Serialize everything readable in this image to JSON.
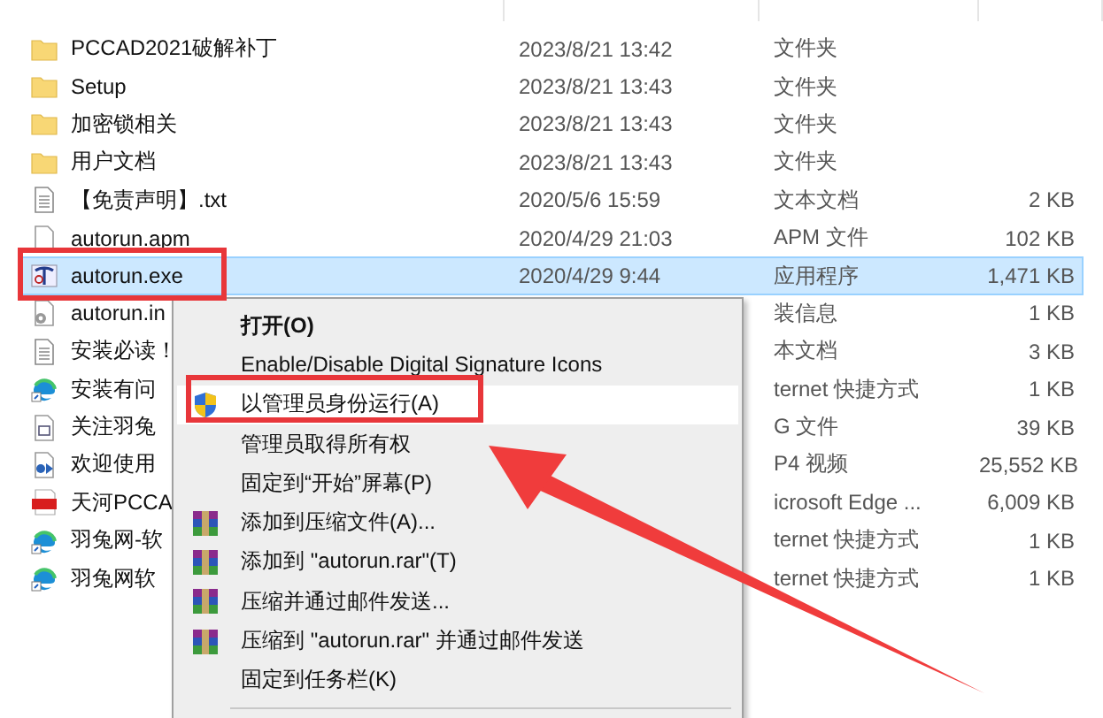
{
  "files": [
    {
      "kind": "folder",
      "name": "PCCAD2021破解补丁",
      "date": "2023/8/21 13:42",
      "type": "文件夹",
      "selected": false
    },
    {
      "kind": "folder",
      "name": "Setup",
      "date": "2023/8/21 13:43",
      "type": "文件夹",
      "selected": false
    },
    {
      "kind": "folder",
      "name": "加密锁相关",
      "date": "2023/8/21 13:43",
      "type": "文件夹",
      "selected": false
    },
    {
      "kind": "folder",
      "name": "用户文档",
      "date": "2023/8/21 13:43",
      "type": "文件夹",
      "selected": false
    },
    {
      "kind": "text",
      "name": "【免责声明】.txt",
      "date": "2020/5/6 15:59",
      "type": "文本文档",
      "size": "2 KB",
      "selected": false
    },
    {
      "kind": "blank",
      "name": "autorun.apm",
      "date": "2020/4/29 21:03",
      "type": "APM 文件",
      "size": "102 KB",
      "selected": false
    },
    {
      "kind": "app",
      "name": "autorun.exe",
      "date": "2020/4/29 9:44",
      "type": "应用程序",
      "size": "1,471 KB",
      "selected": true
    },
    {
      "kind": "config",
      "name": "autorun.in",
      "type": "装信息",
      "size": "1 KB",
      "selected": false
    },
    {
      "kind": "text",
      "name": "安装必读！",
      "type": "本文档",
      "size": "3 KB",
      "selected": false
    },
    {
      "kind": "shortcut",
      "name": "安装有问",
      "type": "ternet 快捷方式",
      "size": "1 KB",
      "selected": false
    },
    {
      "kind": "image",
      "name": "关注羽兔",
      "type": "G 文件",
      "size": "39 KB",
      "selected": false
    },
    {
      "kind": "video",
      "name": "欢迎使用",
      "type": "P4 视频",
      "size": "25,552 KB",
      "selected": false
    },
    {
      "kind": "pdf",
      "name": "天河PCCA",
      "type": "icrosoft Edge ...",
      "size": "6,009 KB",
      "selected": false
    },
    {
      "kind": "shortcut",
      "name": "羽兔网-软",
      "type": "ternet 快捷方式",
      "size": "1 KB",
      "selected": false
    },
    {
      "kind": "shortcut",
      "name": "羽兔网软",
      "type": "ternet 快捷方式",
      "size": "1 KB",
      "selected": false
    }
  ],
  "context_menu": {
    "items": [
      {
        "kind": "plain",
        "label": "打开(O)",
        "bold": true,
        "selected": false
      },
      {
        "kind": "plain",
        "label": "Enable/Disable Digital Signature Icons",
        "bold": false,
        "selected": false
      },
      {
        "kind": "shield",
        "label": "以管理员身份运行(A)",
        "bold": false,
        "selected": true
      },
      {
        "kind": "plain",
        "label": "管理员取得所有权",
        "bold": false,
        "selected": false
      },
      {
        "kind": "plain",
        "label": "固定到“开始”屏幕(P)",
        "bold": false,
        "selected": false
      },
      {
        "kind": "archive",
        "label": "添加到压缩文件(A)...",
        "bold": false,
        "selected": false
      },
      {
        "kind": "archive",
        "label": "添加到 \"autorun.rar\"(T)",
        "bold": false,
        "selected": false
      },
      {
        "kind": "archive",
        "label": "压缩并通过邮件发送...",
        "bold": false,
        "selected": false
      },
      {
        "kind": "archive",
        "label": "压缩到 \"autorun.rar\" 并通过邮件发送",
        "bold": false,
        "selected": false
      },
      {
        "kind": "plain",
        "label": "固定到任务栏(K)",
        "bold": false,
        "selected": false
      }
    ]
  }
}
